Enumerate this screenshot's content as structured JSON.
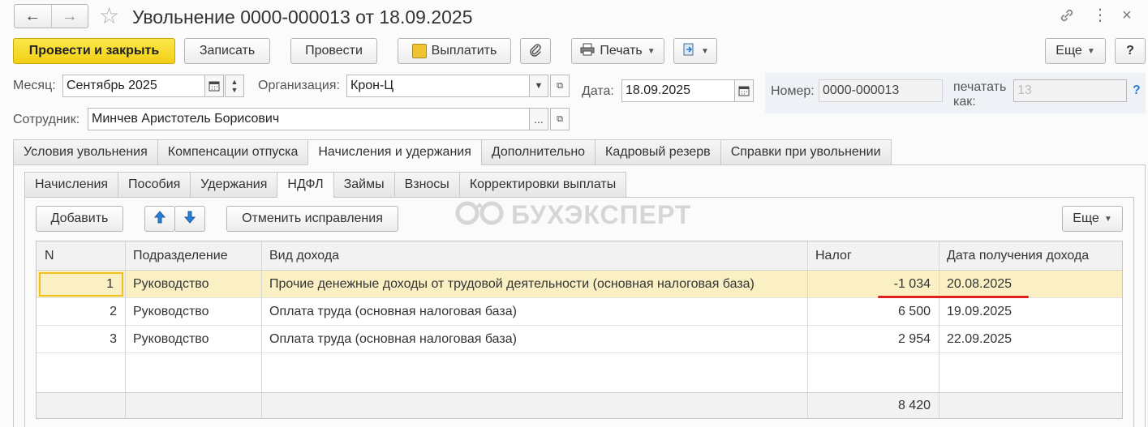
{
  "window": {
    "title": "Увольнение 0000-000013 от 18.09.2025"
  },
  "toolbar": {
    "post_close": "Провести и закрыть",
    "save": "Записать",
    "post": "Провести",
    "pay": "Выплатить",
    "print": "Печать",
    "more": "Еще",
    "help": "?"
  },
  "form": {
    "month_label": "Месяц:",
    "month_value": "Сентябрь 2025",
    "org_label": "Организация:",
    "org_value": "Крон-Ц",
    "date_label": "Дата:",
    "date_value": "18.09.2025",
    "number_label": "Номер:",
    "number_value": "0000-000013",
    "print_as_label_1": "печатать",
    "print_as_label_2": "как:",
    "print_as_value": "13",
    "print_as_help": "?",
    "employee_label": "Сотрудник:",
    "employee_value": "Минчев Аристотель Борисович"
  },
  "main_tabs": [
    "Условия увольнения",
    "Компенсации отпуска",
    "Начисления и удержания",
    "Дополнительно",
    "Кадровый резерв",
    "Справки при увольнении"
  ],
  "sub_tabs": [
    "Начисления",
    "Пособия",
    "Удержания",
    "НДФЛ",
    "Займы",
    "Взносы",
    "Корректировки выплаты"
  ],
  "grid_toolbar": {
    "add": "Добавить",
    "cancel_fixes": "Отменить исправления",
    "more": "Еще"
  },
  "watermark": "БУХЭКСПЕРТ",
  "table": {
    "columns": [
      "N",
      "Подразделение",
      "Вид дохода",
      "Налог",
      "Дата получения дохода"
    ],
    "rows": [
      {
        "n": "1",
        "dept": "Руководство",
        "income": "Прочие денежные доходы от трудовой деятельности (основная налоговая база)",
        "tax": "-1 034",
        "date": "20.08.2025"
      },
      {
        "n": "2",
        "dept": "Руководство",
        "income": "Оплата труда (основная налоговая база)",
        "tax": "6 500",
        "date": "19.09.2025"
      },
      {
        "n": "3",
        "dept": "Руководство",
        "income": "Оплата труда (основная налоговая база)",
        "tax": "2 954",
        "date": "22.09.2025"
      }
    ],
    "total_tax": "8 420"
  },
  "colors": {
    "primary_button": "#f2cf16",
    "selected_row": "#fbf0c4",
    "annotation_underline": "#e02020",
    "arrow_icon": "#2a7fd4"
  }
}
